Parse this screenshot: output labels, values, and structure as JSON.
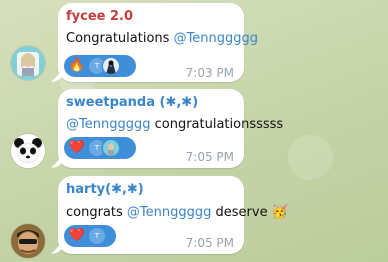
{
  "messages": [
    {
      "sender": "fycee 2.0",
      "sender_color": "#c43c3c",
      "text_prefix": "Congratulations ",
      "mention": "@Tennggggg",
      "text_suffix": "",
      "reaction": "🔥",
      "reactor_initial": "T",
      "time": "7:03 PM"
    },
    {
      "sender": "sweetpanda (✱,✱)",
      "sender_color": "#3a85c9",
      "text_prefix": "",
      "mention": "@Tennggggg",
      "text_suffix": " congratulationsssss",
      "reaction": "❤️",
      "reactor_initial": "T",
      "time": "7:05 PM"
    },
    {
      "sender": "harty(✱,✱)",
      "sender_color": "#3a85c9",
      "text_prefix": "congrats ",
      "mention": "@Tennggggg",
      "text_suffix": " deserve ",
      "emoji": "🥳",
      "reaction": "❤️",
      "reactor_initial": "T",
      "time": "7:05 PM"
    }
  ]
}
